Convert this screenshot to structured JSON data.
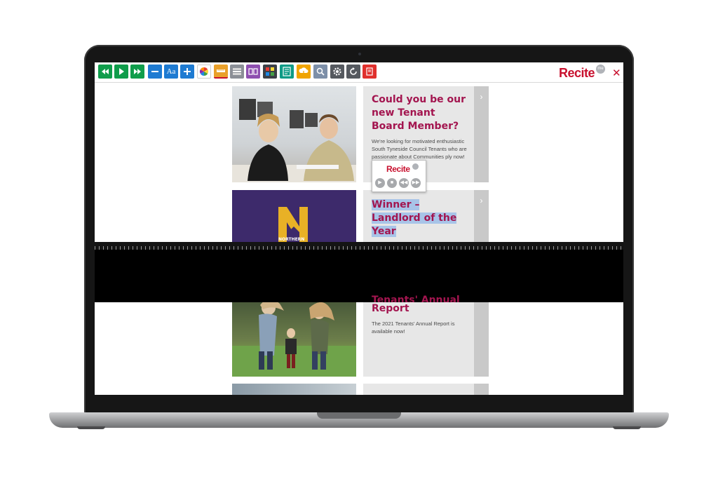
{
  "toolbar": {
    "buttons": [
      "rewind-icon",
      "play-icon",
      "fast-forward-icon",
      "minus-icon",
      "Aa",
      "plus-icon",
      "color-wheel-icon",
      "ruler-icon",
      "screen-mask-icon",
      "dictionary-icon",
      "translate-icon",
      "text-only-icon",
      "download-icon",
      "magnifier-icon",
      "settings-icon",
      "reset-icon",
      "pdf-icon"
    ],
    "font_button_label": "Aa",
    "brand": "Recite",
    "brand_badge": "me",
    "close": "✕"
  },
  "cards": [
    {
      "title": "Could you be our new Tenant Board Member?",
      "body": "We're looking for motivated enthusiastic South Tyneside Council Tenants who are passionate about",
      "body_tail": "Communities",
      "body_end": "ply now!"
    },
    {
      "title": "Winner – Landlord of the Year",
      "logo_text": "NORTHERN"
    },
    {
      "title_partial": "Tenants' Annual",
      "title_end": "Report",
      "body": "The 2021 Tenants' Annual Report is available now!"
    }
  ],
  "mini_player": {
    "brand": "Recite",
    "buttons": [
      "play-icon",
      "stop-icon",
      "rewind-icon",
      "fast-forward-icon"
    ]
  },
  "colors": {
    "accent": "#a3154f",
    "brand": "#c8102e",
    "highlight": "#a8c4e8",
    "toolbar_green": "#0f9d4b",
    "toolbar_blue": "#1e7bd2"
  }
}
